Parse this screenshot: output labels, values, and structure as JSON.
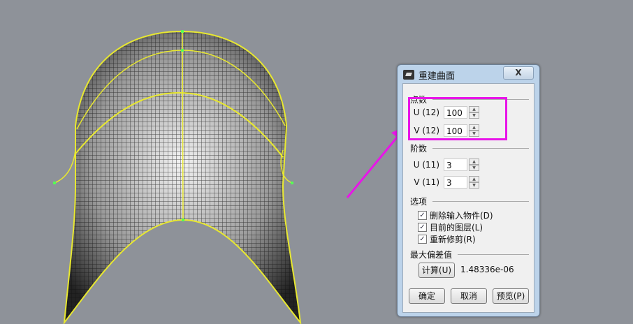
{
  "dialog": {
    "title": "重建曲面",
    "close_label": "X",
    "point_count": {
      "heading": "点数",
      "u_label": "U (12)",
      "u_value": "100",
      "v_label": "V (12)",
      "v_value": "100"
    },
    "degree": {
      "heading": "阶数",
      "u_label": "U (11)",
      "u_value": "3",
      "v_label": "V (11)",
      "v_value": "3"
    },
    "options": {
      "heading": "选项",
      "items": [
        {
          "label": "删除输入物件(D)",
          "checked": true
        },
        {
          "label": "目前的图层(L)",
          "checked": true
        },
        {
          "label": "重新修剪(R)",
          "checked": true
        }
      ]
    },
    "max_deviation": {
      "heading": "最大偏差值",
      "compute_label": "计算(U)",
      "value": "1.48336e-06"
    },
    "buttons": {
      "ok": "确定",
      "cancel": "取消",
      "preview": "预览(P)"
    }
  },
  "colors": {
    "highlight": "#e815e8",
    "curve": "#e8e830",
    "background": "#8e9299"
  }
}
